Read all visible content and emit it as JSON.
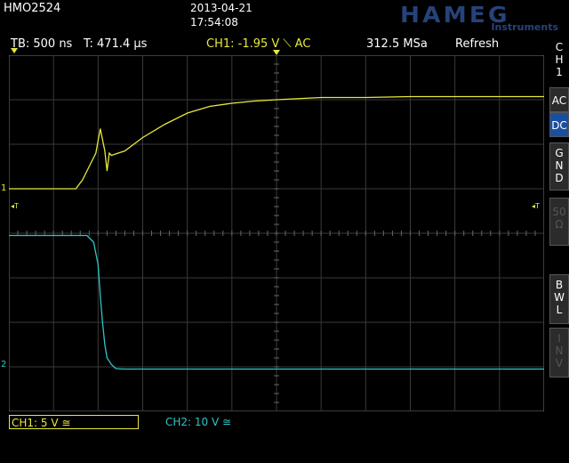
{
  "header": {
    "model": "HMO2524",
    "date": "2013-04-21",
    "time": "17:54:08",
    "brand": "HAMEG",
    "brand_sub": "Instruments"
  },
  "status": {
    "timebase": "TB: 500 ns",
    "trigger_time": "T: 471.4 µs",
    "trigger_info": "CH1: -1.95 V ⟍ AC",
    "sample_rate": "312.5 MSa",
    "mode": "Refresh"
  },
  "side_menu": {
    "channel": [
      "C",
      "H",
      "1"
    ],
    "items": [
      {
        "label": "AC",
        "active": false
      },
      {
        "label": "DC",
        "active": true
      },
      {
        "label": "G\nN\nD",
        "active": false
      },
      {
        "label": "50\nΩ",
        "active": false,
        "dim": true
      },
      {
        "label": "B\nW\nL",
        "active": false
      },
      {
        "label": "I\nN\nV",
        "active": false,
        "dim": true
      }
    ]
  },
  "bottom": {
    "ch1": "CH1: 5 V ≅",
    "ch2": "CH2: 10 V ≅"
  },
  "markers": {
    "ch1": "1",
    "ch2": "2",
    "trig_left": "◂T",
    "trig_right": "◂T"
  },
  "colors": {
    "ch1": "#e8e83c",
    "ch2": "#30c6c6",
    "grid": "#3a3a3a",
    "brand": "#26427a"
  },
  "chart_data": {
    "type": "line",
    "title": "",
    "xlabel": "",
    "ylabel": "",
    "x_divisions": 12,
    "y_divisions": 8,
    "x_unit": "div",
    "y_unit": "div",
    "series": [
      {
        "name": "CH1",
        "color": "#e8e83c",
        "x": [
          0,
          1.5,
          1.65,
          1.8,
          1.95,
          2.05,
          2.15,
          2.2,
          2.25,
          2.3,
          2.6,
          3.0,
          3.5,
          4.0,
          4.5,
          5.0,
          5.5,
          6.0,
          7.0,
          8.0,
          9.0,
          10.0,
          11.0,
          12.0
        ],
        "y": [
          5.0,
          5.0,
          5.2,
          5.5,
          5.8,
          6.35,
          5.85,
          5.4,
          5.8,
          5.75,
          5.85,
          6.15,
          6.45,
          6.7,
          6.85,
          6.92,
          6.97,
          7.0,
          7.05,
          7.05,
          7.07,
          7.07,
          7.07,
          7.07
        ]
      },
      {
        "name": "CH2",
        "color": "#30c6c6",
        "x": [
          0,
          1.75,
          1.9,
          2.0,
          2.05,
          2.1,
          2.15,
          2.2,
          2.3,
          2.4,
          2.6,
          3.0,
          4.0,
          6.0,
          8.0,
          10.0,
          12.0
        ],
        "y": [
          3.95,
          3.95,
          3.8,
          3.3,
          2.6,
          2.0,
          1.5,
          1.2,
          1.05,
          0.96,
          0.95,
          0.95,
          0.95,
          0.95,
          0.95,
          0.95,
          0.95
        ]
      }
    ]
  }
}
